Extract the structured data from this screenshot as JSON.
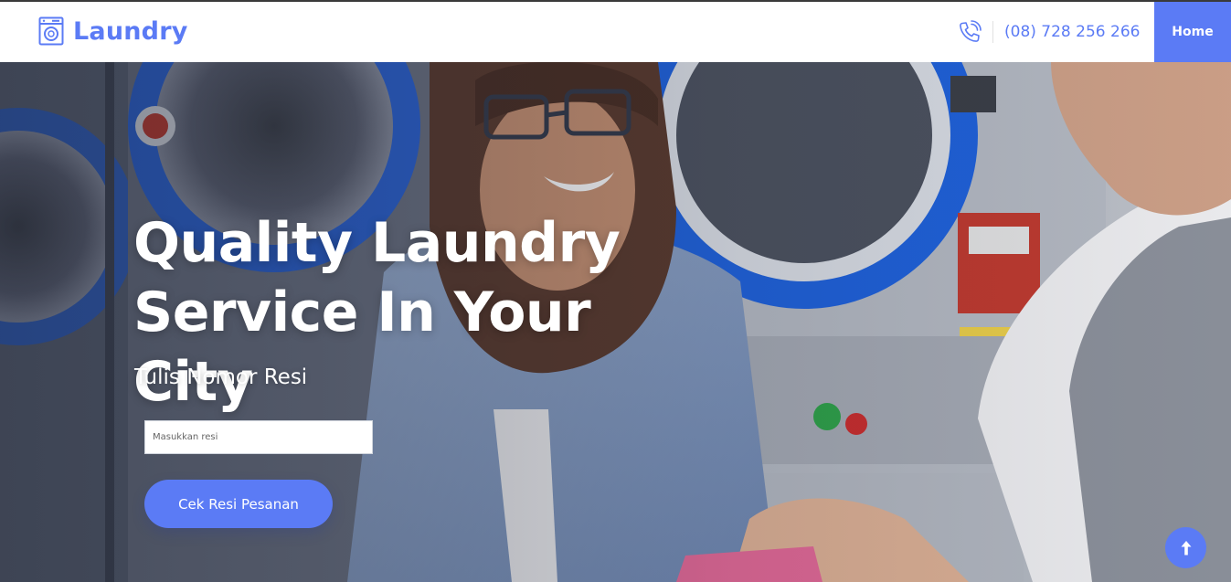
{
  "brand": {
    "name": "Laundry",
    "icon": "washing-machine-icon",
    "color": "#5b7bf5"
  },
  "header": {
    "phone_icon": "phone-ringing-icon",
    "phone": "(08) 728 256 266",
    "nav": [
      {
        "label": "Home",
        "active": true
      }
    ]
  },
  "hero": {
    "background": "laundromat-photo",
    "title_line1": "Quality Laundry",
    "title_line2": "Service In Your City",
    "subtitle": "Tulis Nomor Resi",
    "input": {
      "value": "",
      "placeholder": "Masukkan resi"
    },
    "button_label": "Cek Resi Pesanan"
  },
  "scroll_top": {
    "icon": "arrow-up-icon"
  },
  "colors": {
    "accent": "#5b7bf5",
    "white": "#ffffff"
  }
}
